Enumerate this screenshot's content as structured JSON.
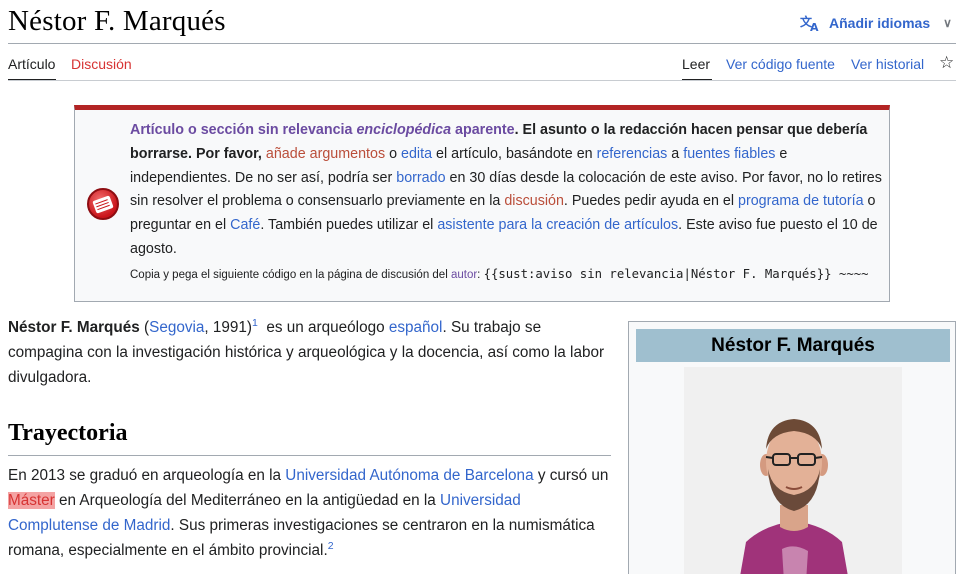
{
  "page": {
    "title": "Néstor F. Marqués",
    "add_languages": "Añadir idiomas",
    "icons": {
      "language": "translate-icon",
      "chevron": "chevron-down-icon",
      "watch": "star-icon"
    }
  },
  "tabs": {
    "article": "Artículo",
    "talk": "Discusión",
    "read": "Leer",
    "view_source": "Ver código fuente",
    "history": "Ver historial"
  },
  "notice": {
    "heading_a": "Artículo o sección sin relevancia ",
    "heading_em": "enciclopédica",
    "heading_b": " aparente",
    "t1": ". El asunto o la redacción hacen pensar que debería borrarse. Por favor, ",
    "l_add_arguments": "añade argumentos",
    "t2": " o ",
    "l_edit": "edita",
    "t3": " el artículo, basándote en ",
    "l_references": "referencias",
    "t4": " a ",
    "l_reliable_sources": "fuentes fiables",
    "t5": " e independientes. De no ser así, podría ser ",
    "l_deleted": "borrado",
    "t6": " en 30 días desde la colocación de este aviso. Por favor, no lo retires sin resolver el problema o consensuarlo previamente en la ",
    "l_discussion": "discusión",
    "t7": ". Puedes pedir ayuda en el ",
    "l_tutoring": "programa de tutoría",
    "t8": " o preguntar en el ",
    "l_cafe": "Café",
    "t9": ". También puedes utilizar el ",
    "l_wizard": "asistente para la creación de artículos",
    "t10": ". Este aviso fue puesto el 10 de agosto.",
    "small_a": "Copia y pega el siguiente código en la página de discusión del ",
    "small_author": "autor",
    "small_b": ": ",
    "small_code": "{{sust:aviso sin relevancia|Néstor F. Marqués}} ~~~~"
  },
  "infobox": {
    "title": "Néstor F. Marqués"
  },
  "intro": {
    "name": "Néstor F. Marqués",
    "t1": " (",
    "l_segovia": "Segovia",
    "t2": ", 1991)",
    "ref1": "1",
    "t3": "  es un arqueólogo ",
    "l_spanish": "español",
    "t4": ". Su trabajo se compagina con la investigación histórica y arqueológica y la docencia, así como la labor divulgadora."
  },
  "section": {
    "heading": "Trayectoria"
  },
  "career": {
    "t1": "En 2013 se graduó en arqueología en la ",
    "l_uab": "Universidad Autónoma de Barcelona",
    "t2": " y cursó un ",
    "l_master": "Máster",
    "t3": " en Arqueología del Mediterráneo en la antigüedad en la ",
    "l_ucm": "Universidad Complutense de Madrid",
    "t4": ". Sus primeras investigaciones se centraron en la numismática romana, especialmente en el ámbito provincial.",
    "ref2": "2"
  }
}
